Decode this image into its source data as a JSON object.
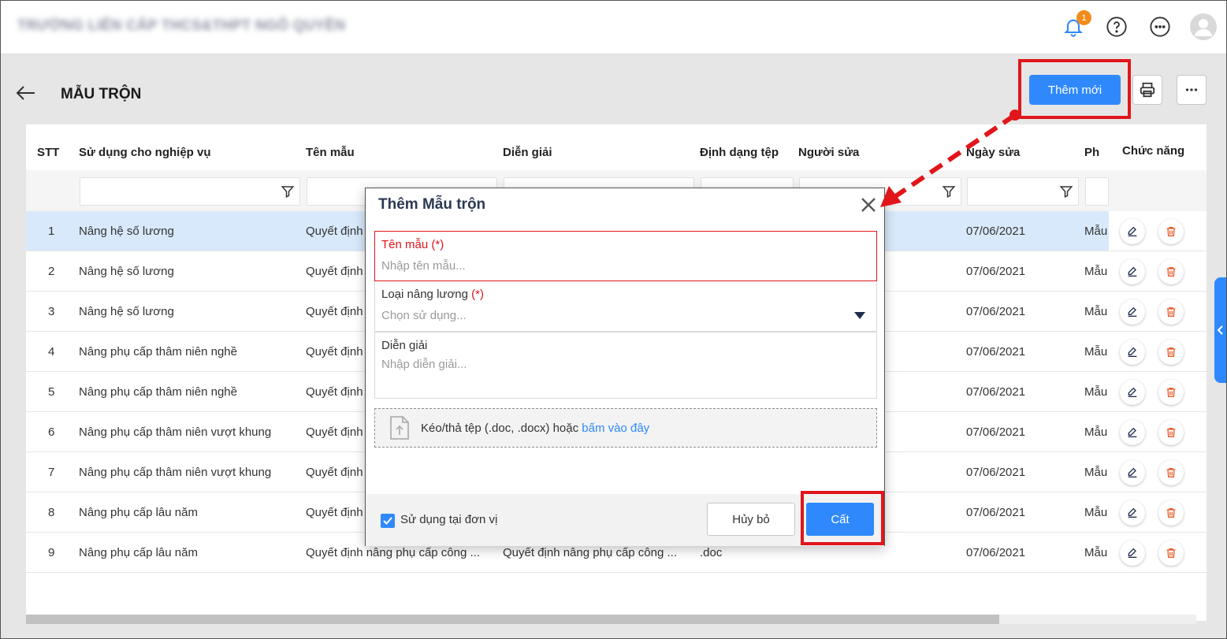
{
  "header": {
    "school_name": "TRƯỜNG LIÊN CẤP THCS&THPT NGÔ QUYỀN",
    "notification_count": "1"
  },
  "page": {
    "title": "MẪU TRỘN",
    "add_label": "Thêm mới"
  },
  "table": {
    "columns": [
      "STT",
      "Sử dụng cho nghiệp vụ",
      "Tên mẫu",
      "Diễn giải",
      "Định dạng tệp",
      "Người sửa",
      "Ngày sửa",
      "Ph",
      "Chức năng"
    ],
    "rows": [
      {
        "stt": "1",
        "nghiep_vu": "Nâng hệ số lương",
        "ten_mau": "Quyết định",
        "dien_giai": "",
        "dinh_dang": "",
        "ngay_sua": "07/06/2021",
        "ph": "Mẫu"
      },
      {
        "stt": "2",
        "nghiep_vu": "Nâng hệ số lương",
        "ten_mau": "Quyết định",
        "dien_giai": "",
        "dinh_dang": "",
        "ngay_sua": "07/06/2021",
        "ph": "Mẫu"
      },
      {
        "stt": "3",
        "nghiep_vu": "Nâng hệ số lương",
        "ten_mau": "Quyết định",
        "dien_giai": "",
        "dinh_dang": "",
        "ngay_sua": "07/06/2021",
        "ph": "Mẫu"
      },
      {
        "stt": "4",
        "nghiep_vu": "Nâng phụ cấp thâm niên nghề",
        "ten_mau": "Quyết định",
        "dien_giai": "",
        "dinh_dang": "",
        "ngay_sua": "07/06/2021",
        "ph": "Mẫu"
      },
      {
        "stt": "5",
        "nghiep_vu": "Nâng phụ cấp thâm niên nghề",
        "ten_mau": "Quyết định",
        "dien_giai": "",
        "dinh_dang": "",
        "ngay_sua": "07/06/2021",
        "ph": "Mẫu"
      },
      {
        "stt": "6",
        "nghiep_vu": "Nâng phụ cấp thâm niên vượt khung",
        "ten_mau": "Quyết định",
        "dien_giai": "",
        "dinh_dang": "",
        "ngay_sua": "07/06/2021",
        "ph": "Mẫu"
      },
      {
        "stt": "7",
        "nghiep_vu": "Nâng phụ cấp thâm niên vượt khung",
        "ten_mau": "Quyết định",
        "dien_giai": "",
        "dinh_dang": "",
        "ngay_sua": "07/06/2021",
        "ph": "Mẫu"
      },
      {
        "stt": "8",
        "nghiep_vu": "Nâng phụ cấp lâu năm",
        "ten_mau": "Quyết định",
        "dien_giai": "",
        "dinh_dang": "",
        "ngay_sua": "07/06/2021",
        "ph": "Mẫu"
      },
      {
        "stt": "9",
        "nghiep_vu": "Nâng phụ cấp lâu năm",
        "ten_mau": "Quyết định nâng phụ cấp công ...",
        "dien_giai": "Quyết định nâng phụ cấp công ...",
        "dinh_dang": ".doc",
        "ngay_sua": "07/06/2021",
        "ph": "Mẫu"
      }
    ]
  },
  "dialog": {
    "title": "Thêm Mẫu trộn",
    "name_label": "Tên mẫu",
    "required_mark": "(*)",
    "name_placeholder": "Nhập tên mẫu...",
    "type_label": "Loại nâng lương",
    "type_placeholder": "Chọn sử dụng...",
    "desc_label": "Diễn giải",
    "desc_placeholder": "Nhập diễn giải...",
    "upload_text": "Kéo/thả tệp (.doc, .docx) hoặc",
    "upload_link": "bấm vào đây",
    "use_at_unit_label": "Sử dụng tại đơn vị",
    "use_at_unit_checked": true,
    "cancel_label": "Hủy bỏ",
    "save_label": "Cất"
  },
  "colors": {
    "accent": "#2f89fc",
    "highlight": "#e0161b",
    "selected_row": "#d8e9fb",
    "badge": "#f28b1a"
  }
}
